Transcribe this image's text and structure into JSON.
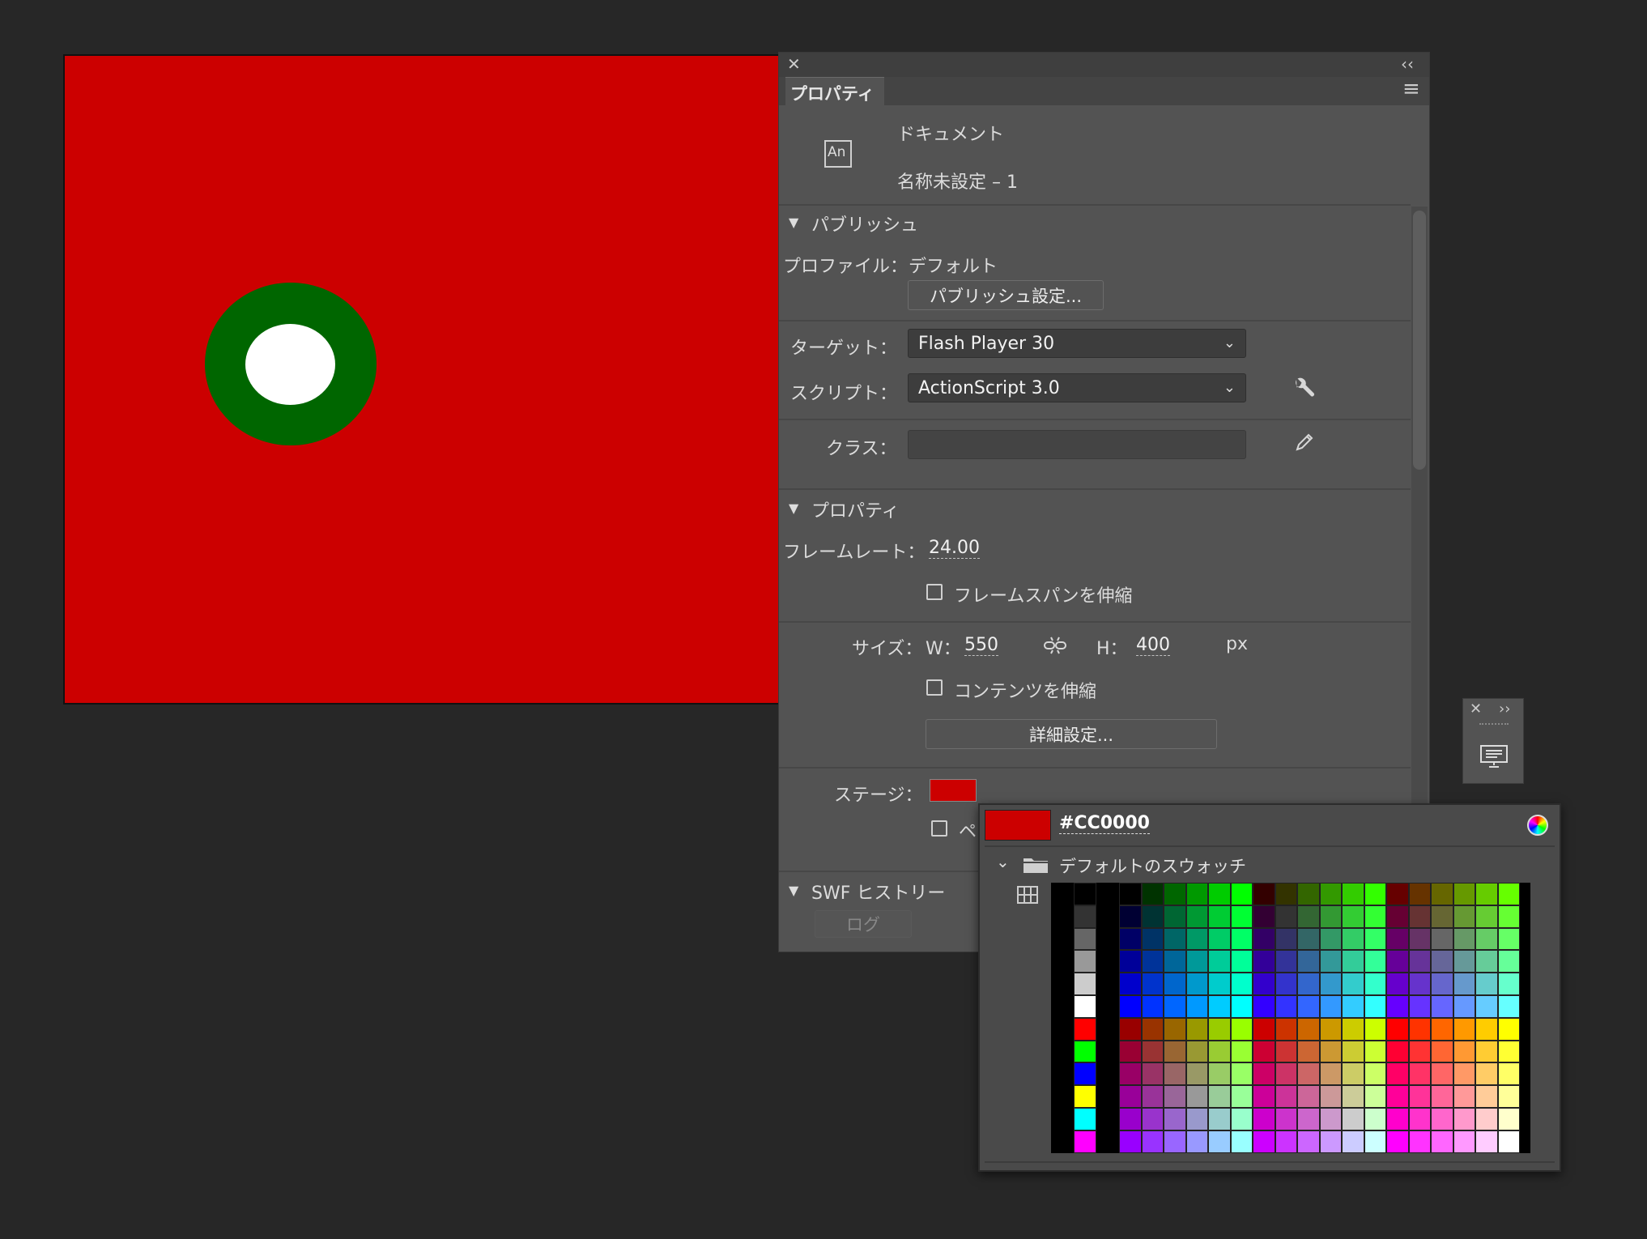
{
  "stage": {
    "background": "#cc0000",
    "ring_color": "#006600",
    "hole_color": "#ffffff"
  },
  "panel": {
    "close_glyph": "✕",
    "collapse_glyph": "‹‹",
    "tab_label": "プロパティ",
    "menu_glyph": "≡",
    "doc_icon_text": "An",
    "doc_type": "ドキュメント",
    "doc_name": "名称未設定 – 1",
    "publish": {
      "header": "パブリッシュ",
      "profile_label": "プロファイル：",
      "profile_value": "デフォルト",
      "settings_button": "パブリッシュ設定...",
      "target_label": "ターゲット：",
      "target_value": "Flash Player 30",
      "script_label": "スクリプト：",
      "script_value": "ActionScript 3.0",
      "class_label": "クラス："
    },
    "properties": {
      "header": "プロパティ",
      "framerate_label": "フレームレート：",
      "framerate_value": "24.00",
      "scale_spans_label": "フレームスパンを伸縮",
      "size_label": "サイズ：",
      "w_label": "W：",
      "w_value": "550",
      "h_label": "H：",
      "h_value": "400",
      "unit": "px",
      "scale_content_label": "コンテンツを伸縮",
      "advanced_button": "詳細設定...",
      "stage_label": "ステージ：",
      "stage_color": "#cc0000",
      "partial_label": "ペ"
    },
    "swf_history": {
      "header": "SWF ヒストリー",
      "log_button": "ログ"
    }
  },
  "picker": {
    "hex": "#CC0000",
    "current_color": "#cc0000",
    "folder_label": "デフォルトのスウォッチ",
    "side_colors": [
      "#000000",
      "#333333",
      "#666666",
      "#999999",
      "#cccccc",
      "#ffffff",
      "#ff0000",
      "#00ff00",
      "#0000ff",
      "#ffff00",
      "#00ffff",
      "#ff00ff"
    ]
  },
  "mini_panel": {
    "close_glyph": "✕",
    "expand_glyph": "››"
  }
}
